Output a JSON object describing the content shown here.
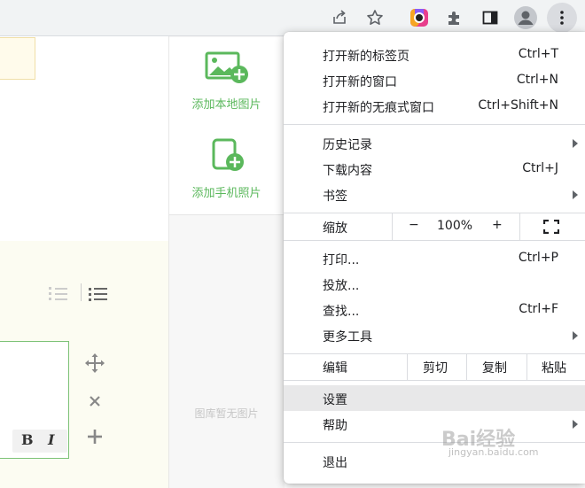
{
  "toolbar": {
    "icons": [
      "share-icon",
      "star-icon",
      "colorful-extension-icon",
      "puzzle-extensions-icon",
      "side-panel-icon",
      "profile-avatar-icon",
      "more-vert-icon"
    ]
  },
  "editor": {
    "format_bold": "B",
    "format_italic": "I"
  },
  "image_panel": {
    "add_local_label": "添加本地图片",
    "add_phone_label": "添加手机照片",
    "empty_label": "图库暂无图片",
    "accent_color": "#5bb85c"
  },
  "menu": {
    "new_tab": {
      "label": "打开新的标签页",
      "shortcut": "Ctrl+T"
    },
    "new_window": {
      "label": "打开新的窗口",
      "shortcut": "Ctrl+N"
    },
    "incognito": {
      "label": "打开新的无痕式窗口",
      "shortcut": "Ctrl+Shift+N"
    },
    "history": {
      "label": "历史记录"
    },
    "downloads": {
      "label": "下载内容",
      "shortcut": "Ctrl+J"
    },
    "bookmarks": {
      "label": "书签"
    },
    "zoom": {
      "label": "缩放",
      "minus": "−",
      "value": "100%",
      "plus": "+"
    },
    "print": {
      "label": "打印...",
      "shortcut": "Ctrl+P"
    },
    "cast": {
      "label": "投放..."
    },
    "find": {
      "label": "查找...",
      "shortcut": "Ctrl+F"
    },
    "more_tools": {
      "label": "更多工具"
    },
    "edit": {
      "label": "编辑",
      "cut": "剪切",
      "copy": "复制",
      "paste": "粘贴"
    },
    "settings": {
      "label": "设置"
    },
    "help": {
      "label": "帮助"
    },
    "exit": {
      "label": "退出"
    }
  },
  "watermark": {
    "main": "Bai经验",
    "sub": "jingyan.baidu.com"
  }
}
